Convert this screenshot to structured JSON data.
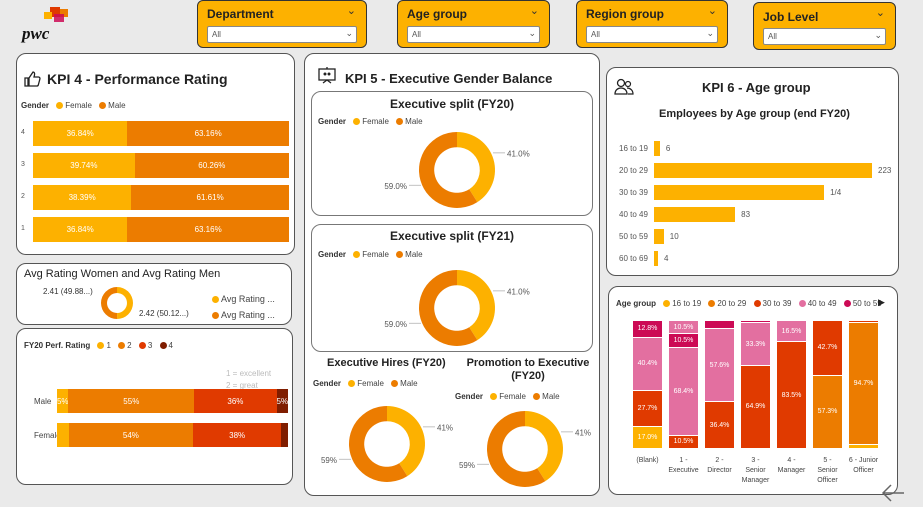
{
  "brand": {
    "logo_text": "pwc"
  },
  "colors": {
    "female": "#fdb100",
    "male": "#ec7c00",
    "r1": "#fdb100",
    "r2": "#ec7c00",
    "r3": "#e03a00",
    "r4": "#7f1d00",
    "a16": "#fdb100",
    "a20": "#ec7c00",
    "a30": "#e03a00",
    "a40": "#e36fa0",
    "a50": "#cc0a55"
  },
  "slicers": [
    {
      "label": "Department",
      "value": "All"
    },
    {
      "label": "Age group",
      "value": "All"
    },
    {
      "label": "Region group",
      "value": "All"
    },
    {
      "label": "Job Level",
      "value": "All"
    }
  ],
  "kpi4": {
    "title": "KPI 4 - Performance Rating",
    "legend_title": "Gender",
    "legend": [
      "Female",
      "Male"
    ],
    "rows": [
      {
        "label": "4",
        "female": 36.84,
        "male": 63.16,
        "female_text": "36.84%",
        "male_text": "63.16%"
      },
      {
        "label": "3",
        "female": 39.74,
        "male": 60.26,
        "female_text": "39.74%",
        "male_text": "60.26%"
      },
      {
        "label": "2",
        "female": 38.39,
        "male": 61.61,
        "female_text": "38.39%",
        "male_text": "61.61%"
      },
      {
        "label": "1",
        "female": 36.84,
        "male": 63.16,
        "female_text": "36.84%",
        "male_text": "63.16%"
      }
    ]
  },
  "avg_rating": {
    "title": "Avg Rating Women and Avg Rating Men",
    "women_fraction": 0.4988,
    "women_label": "2.41 (49.88...)",
    "men_label": "2.42 (50.12...)",
    "legend": [
      "Avg Rating ...",
      "Avg Rating ..."
    ]
  },
  "fy20perf": {
    "legend_title": "FY20 Perf. Rating",
    "legend": [
      "1",
      "2",
      "3",
      "4"
    ],
    "notes": [
      "1 = excellent",
      "2 = great"
    ],
    "rows": [
      {
        "label": "Male",
        "values": [
          5,
          55,
          36,
          5
        ],
        "texts": [
          "5%",
          "55%",
          "36%",
          "5%"
        ]
      },
      {
        "label": "Female",
        "values": [
          5,
          54,
          38,
          3
        ],
        "texts": [
          "",
          "54%",
          "38%",
          ""
        ]
      }
    ]
  },
  "kpi5": {
    "title": "KPI 5 - Executive Gender Balance",
    "split20": {
      "title": "Executive split (FY20)",
      "legend_title": "Gender",
      "legend": [
        "Female",
        "Male"
      ],
      "female": 41.0,
      "male": 59.0,
      "female_text": "41.0%",
      "male_text": "59.0%"
    },
    "split21": {
      "title": "Executive split (FY21)",
      "legend_title": "Gender",
      "legend": [
        "Female",
        "Male"
      ],
      "female": 41.0,
      "male": 59.0,
      "female_text": "41.0%",
      "male_text": "59.0%"
    },
    "hires": {
      "title": "Executive Hires (FY20)",
      "legend_title": "Gender",
      "legend": [
        "Female",
        "Male"
      ],
      "female": 41,
      "male": 59,
      "female_text": "41%",
      "male_text": "59%"
    },
    "promo": {
      "title": "Promotion to Executive (FY20)",
      "legend_title": "Gender",
      "legend": [
        "Female",
        "Male"
      ],
      "female": 41,
      "male": 59,
      "female_text": "41%",
      "male_text": "59%"
    }
  },
  "kpi6": {
    "title": "KPI 6 - Age group",
    "subtitle": "Employees by Age group (end FY20)",
    "rows": [
      {
        "label": "16 to 19",
        "value": 6,
        "text": "6"
      },
      {
        "label": "20 to 29",
        "value": 223,
        "text": "223"
      },
      {
        "label": "30 to 39",
        "value": 174,
        "text": "1/4"
      },
      {
        "label": "40 to 49",
        "value": 83,
        "text": "83"
      },
      {
        "label": "50 to 59",
        "value": 10,
        "text": "10"
      },
      {
        "label": "60 to 69",
        "value": 4,
        "text": "4"
      }
    ]
  },
  "age_stack": {
    "legend_title": "Age group",
    "legend": [
      "16 to 19",
      "20 to 29",
      "30 to 39",
      "40 to 49",
      "50 to 59"
    ],
    "columns": [
      {
        "label": [
          "(Blank)"
        ],
        "segs": [
          17.0,
          0,
          27.7,
          40.4,
          12.8
        ],
        "texts": [
          "17.0%",
          "",
          "27.7%",
          "40.4%",
          "12.8%"
        ]
      },
      {
        "label": [
          "1 -",
          "Executive"
        ],
        "segs": [
          0,
          0,
          10.5,
          68.4,
          10.5,
          10.5
        ],
        "texts": [
          "",
          "",
          "10.5%",
          "68.4%",
          "10.5%",
          "10.5%"
        ]
      },
      {
        "label": [
          "2 -",
          "Director"
        ],
        "segs": [
          0,
          0,
          36.4,
          57.6,
          6
        ],
        "texts": [
          "",
          "",
          "36.4%",
          "57.6%",
          ""
        ]
      },
      {
        "label": [
          "3 -",
          "Senior",
          "Manager"
        ],
        "segs": [
          0,
          0,
          64.9,
          33.3,
          1.8
        ],
        "texts": [
          "",
          "",
          "64.9%",
          "33.3%",
          ""
        ]
      },
      {
        "label": [
          "4 -",
          "Manager"
        ],
        "segs": [
          0,
          0,
          83.5,
          16.5,
          0
        ],
        "texts": [
          "",
          "",
          "83.5%",
          "16.5%",
          ""
        ]
      },
      {
        "label": [
          "5 -",
          "Senior",
          "Officer"
        ],
        "segs": [
          0,
          57.3,
          42.7,
          0,
          0
        ],
        "texts": [
          "",
          "57.3%",
          "42.7%",
          "",
          ""
        ]
      },
      {
        "label": [
          "6 - Junior",
          "Officer"
        ],
        "segs": [
          3.5,
          94.7,
          1.8,
          0,
          0
        ],
        "texts": [
          "",
          "94.7%",
          "",
          "",
          ""
        ]
      }
    ]
  }
}
